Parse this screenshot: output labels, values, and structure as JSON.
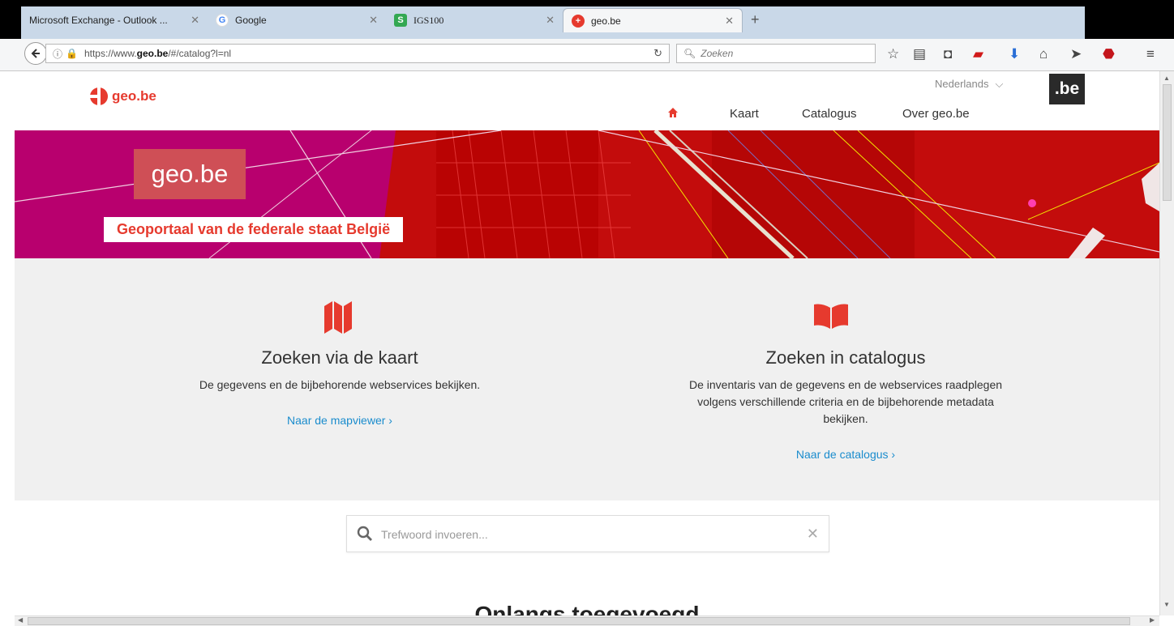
{
  "browser": {
    "tabs": [
      {
        "title": "Microsoft Exchange - Outlook ...",
        "favicon": "outlook-icon",
        "active": false
      },
      {
        "title": "Google",
        "favicon": "google-icon",
        "active": false
      },
      {
        "title": "IGS100",
        "favicon": "s-icon",
        "active": false
      },
      {
        "title": "geo.be",
        "favicon": "geo-icon",
        "active": true
      }
    ],
    "url_prefix": "https://www.",
    "url_domain": "geo.be",
    "url_suffix": "/#/catalog?l=nl",
    "search_placeholder": "Zoeken"
  },
  "header": {
    "logo_text": "geo.be",
    "language": "Nederlands",
    "be_badge": ".be",
    "nav": [
      "Kaart",
      "Catalogus",
      "Over geo.be"
    ]
  },
  "hero": {
    "title": "geo.be",
    "subtitle": "Geoportaal van de federale staat België"
  },
  "options": [
    {
      "icon": "map-icon",
      "title": "Zoeken via de kaart",
      "desc_lines": [
        "De gegevens en de bijbehorende webservices bekijken."
      ],
      "link": "Naar de mapviewer"
    },
    {
      "icon": "book-icon",
      "title": "Zoeken in catalogus",
      "desc_lines": [
        "De inventaris van de gegevens en de webservices raadplegen",
        "volgens verschillende criteria en de bijbehorende metadata",
        "bekijken."
      ],
      "link": "Naar de catalogus"
    }
  ],
  "search": {
    "placeholder": "Trefwoord invoeren..."
  },
  "recent_heading": "Onlangs toegevoegd",
  "colors": {
    "accent": "#e63a2e",
    "link": "#1a8ccd",
    "hero_magenta": "#a4006b",
    "hero_red": "#c80a0a"
  }
}
